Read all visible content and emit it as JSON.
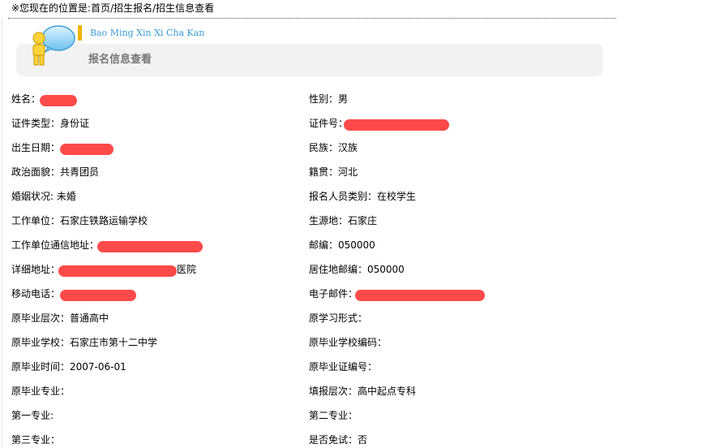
{
  "breadcrumb": "※您现在的位置是:首页/招生报名/招生信息查看",
  "header": {
    "pinyin": "Bao Ming Xin Xi Cha Kan",
    "title": "报名信息查看"
  },
  "fields": {
    "name": "姓名：",
    "gender": "性别：男",
    "id_type": "证件类型：身份证",
    "id_number": "证件号：",
    "birthdate": "出生日期：",
    "ethnicity": "民族：汉族",
    "political": "政治面貌：共青团员",
    "origin": "籍贯：河北",
    "marital": "婚姻状况: 未婚",
    "applicant_type": "报名人员类别：在校学生",
    "employer": "工作单位：石家庄铁路运输学校",
    "source_region": "生源地：石家庄",
    "work_address": "工作单位通信地址：",
    "postcode": "邮编：050000",
    "detail_address_label": "详细地址：",
    "detail_address_tail": "医院",
    "home_postcode": "居住地邮编：050000",
    "mobile": "移动电话：",
    "email": "电子邮件：",
    "prev_level": "原毕业层次：普通高中",
    "prev_study_form": "原学习形式：",
    "prev_school": "原毕业学校：石家庄市第十二中学",
    "prev_school_code": "原毕业学校编码：",
    "grad_time": "原毕业时间：2007-06-01",
    "grad_cert_no": "原毕业证编号：",
    "prev_major": "原毕业专业：",
    "apply_level": "填报层次：高中起点专科",
    "major1": "第一专业:",
    "major2": "第二专业：",
    "major3": "第三专业：",
    "exam_exempt": "是否免试：否"
  },
  "colors": {
    "redaction": "#ff4a4a",
    "pinyin": "#3a9ad9",
    "accent": "#f0b400"
  }
}
